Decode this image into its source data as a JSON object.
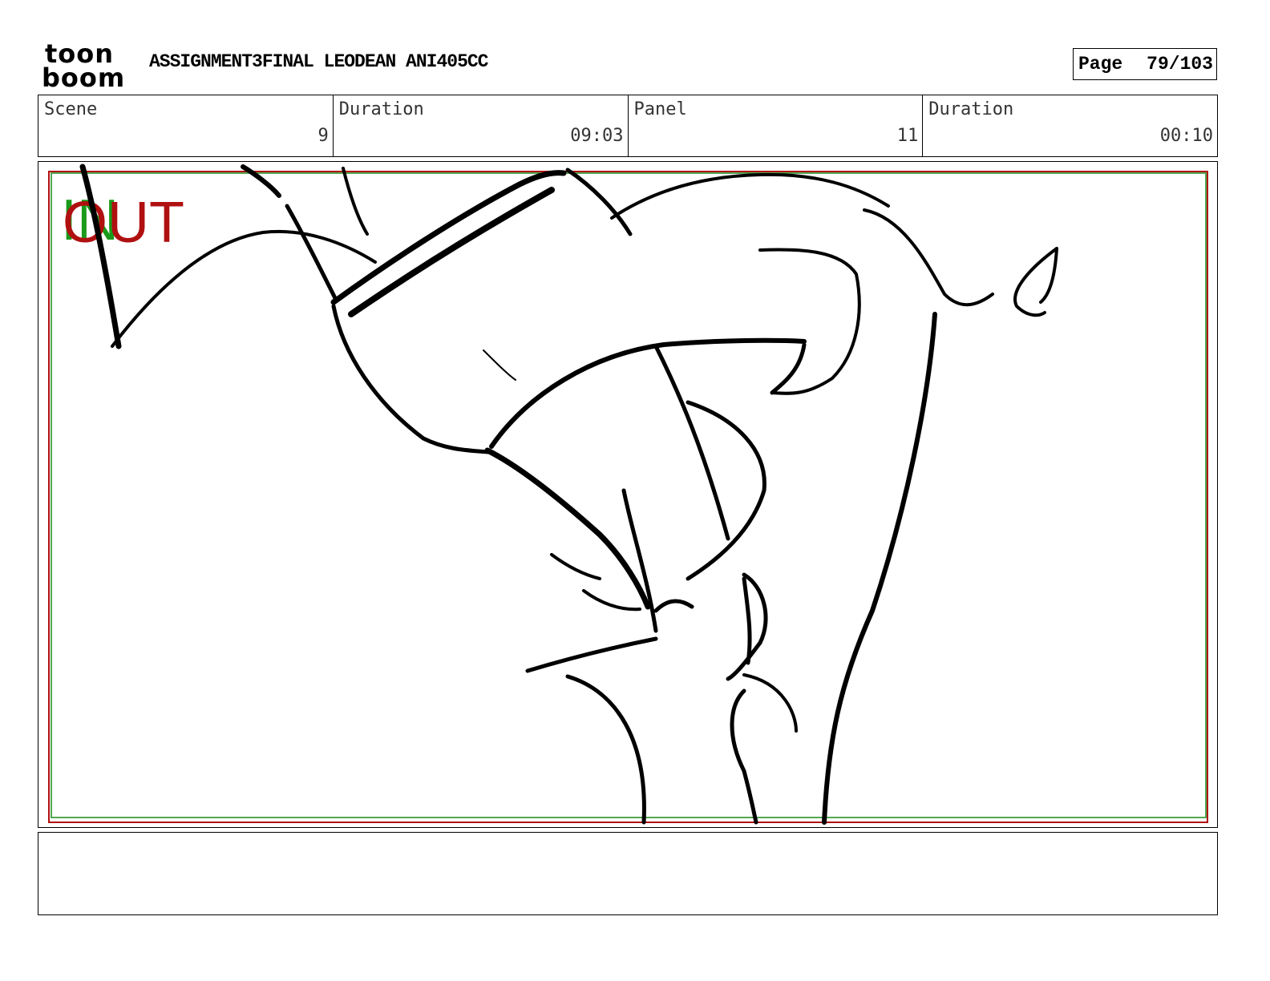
{
  "logo": {
    "line1": "toon",
    "line2": "boom"
  },
  "header": {
    "title": "ASSIGNMENT3FINAL LEODEAN ANI405CC",
    "page_label": "Page",
    "page_value": "79/103"
  },
  "info": {
    "scene_label": "Scene",
    "scene_value": "9",
    "scene_duration_label": "Duration",
    "scene_duration_value": "09:03",
    "panel_label": "Panel",
    "panel_value": "11",
    "panel_duration_label": "Duration",
    "panel_duration_value": "00:10"
  },
  "overlay": {
    "in_text": "IN",
    "out_text": "OUT"
  },
  "colors": {
    "in": "#1a9a1a",
    "out": "#b01010",
    "safe_frame_red": "#b01010",
    "safe_frame_green": "#1a8a1a"
  },
  "notes": {
    "text": ""
  }
}
